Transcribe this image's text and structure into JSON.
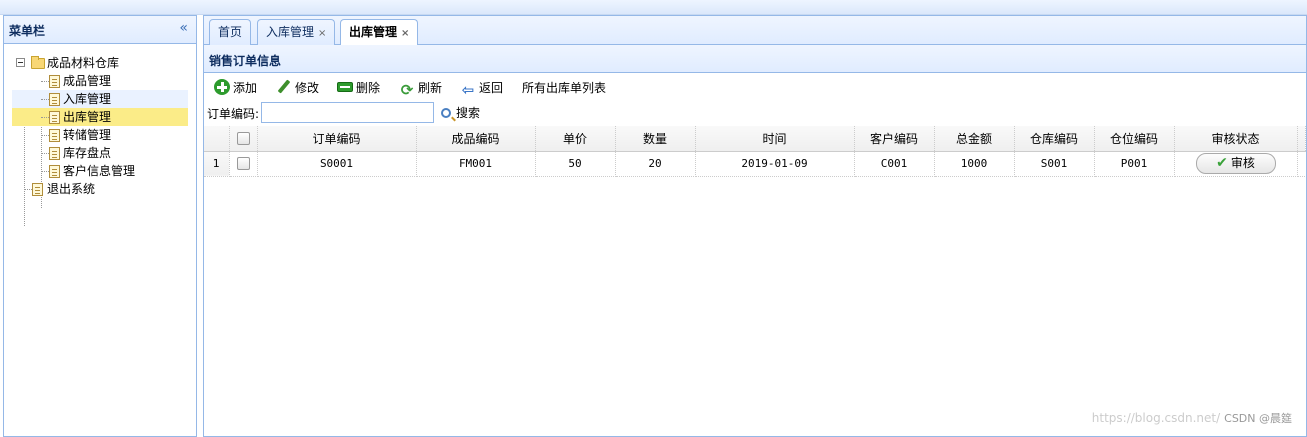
{
  "sidebar": {
    "title": "菜单栏",
    "tree": {
      "root_label": "成品材料仓库",
      "items": [
        {
          "label": "成品管理"
        },
        {
          "label": "入库管理"
        },
        {
          "label": "出库管理"
        },
        {
          "label": "转储管理"
        },
        {
          "label": "库存盘点"
        },
        {
          "label": "客户信息管理"
        }
      ],
      "exit_label": "退出系统"
    }
  },
  "tabs": [
    {
      "label": "首页",
      "closable": false
    },
    {
      "label": "入库管理",
      "closable": true
    },
    {
      "label": "出库管理",
      "closable": true,
      "active": true
    }
  ],
  "panel": {
    "title": "销售订单信息"
  },
  "toolbar": {
    "add_label": "添加",
    "edit_label": "修改",
    "delete_label": "删除",
    "refresh_label": "刷新",
    "back_label": "返回",
    "list_label": "所有出库单列表"
  },
  "search": {
    "label": "订单编码:",
    "value": "",
    "button_label": "搜索"
  },
  "grid": {
    "columns": [
      "订单编码",
      "成品编码",
      "单价",
      "数量",
      "时间",
      "客户编码",
      "总金额",
      "仓库编码",
      "仓位编码",
      "审核状态"
    ],
    "rows": [
      {
        "num": "1",
        "order": "S0001",
        "product": "FM001",
        "price": "50",
        "qty": "20",
        "time": "2019-01-09",
        "customer": "C001",
        "total": "1000",
        "warehouse": "S001",
        "location": "P001",
        "audit_label": "审核"
      }
    ]
  },
  "watermark": {
    "url": "https://blog.csdn.net/",
    "author": "CSDN @晨筵"
  },
  "colors": {
    "border": "#95b8e7",
    "header_bg": "#e0ecff",
    "selected": "#fbec88",
    "title": "#0e2d5f"
  }
}
